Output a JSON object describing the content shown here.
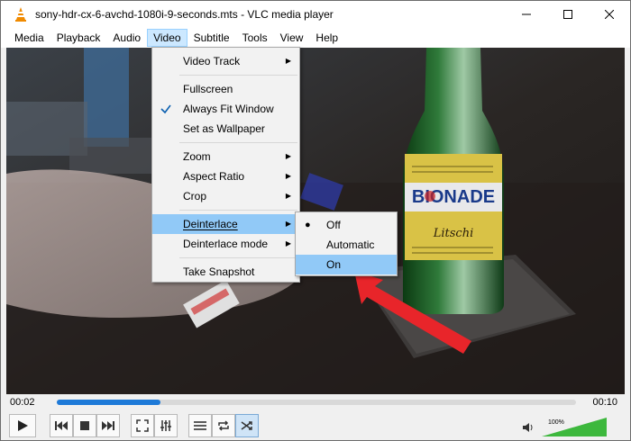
{
  "window": {
    "title": "sony-hdr-cx-6-avchd-1080i-9-seconds.mts - VLC media player"
  },
  "menubar": [
    "Media",
    "Playback",
    "Audio",
    "Video",
    "Subtitle",
    "Tools",
    "View",
    "Help"
  ],
  "video_menu": {
    "video_track": "Video Track",
    "fullscreen": "Fullscreen",
    "always_fit": "Always Fit Window",
    "wallpaper": "Set as Wallpaper",
    "zoom": "Zoom",
    "aspect_ratio": "Aspect Ratio",
    "crop": "Crop",
    "deinterlace": "Deinterlace",
    "deinterlace_mode": "Deinterlace mode",
    "snapshot": "Take Snapshot"
  },
  "deinterlace_submenu": {
    "off": "Off",
    "automatic": "Automatic",
    "on": "On",
    "selected": "Off"
  },
  "bottle_label": {
    "brand": "BIONADE",
    "flavor": "Litschi"
  },
  "playback": {
    "elapsed": "00:02",
    "total": "00:10",
    "progress_fraction": 0.2
  },
  "volume": {
    "label": "100%",
    "level_fraction": 1.0
  },
  "colors": {
    "menu_highlight": "#91c9f7",
    "seek_fill": "#1e7ad8",
    "volume_green": "#3db83d",
    "arrow_red": "#e8252a"
  }
}
